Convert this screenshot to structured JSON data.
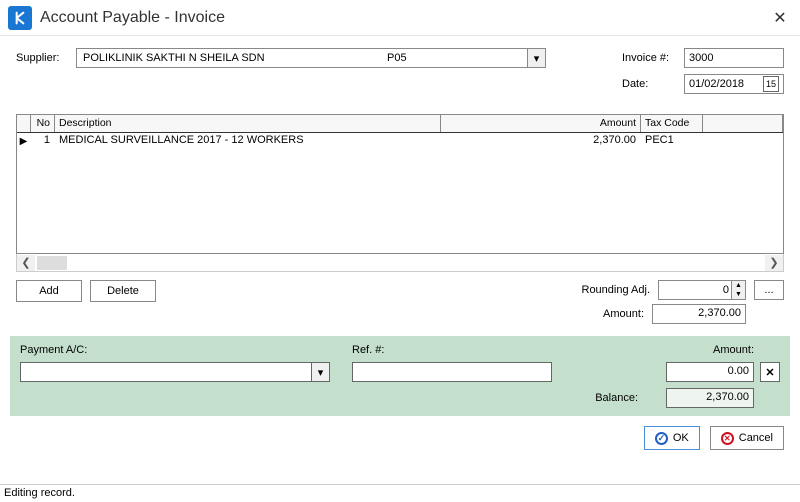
{
  "window": {
    "title": "Account Payable - Invoice"
  },
  "labels": {
    "supplier": "Supplier:",
    "invoice_no": "Invoice #:",
    "date": "Date:",
    "rounding_adj": "Rounding Adj.",
    "amount": "Amount:",
    "payment_ac": "Payment A/C:",
    "ref_no": "Ref. #:",
    "pay_amount": "Amount:",
    "balance": "Balance:"
  },
  "supplier": {
    "name": "POLIKLINIK SAKTHI N SHEILA SDN",
    "code": "P05"
  },
  "invoice": {
    "number": "3000",
    "date": "01/02/2018"
  },
  "grid": {
    "headers": {
      "no": "No",
      "description": "Description",
      "amount": "Amount",
      "tax_code": "Tax Code"
    },
    "rows": [
      {
        "no": "1",
        "description": "MEDICAL SURVEILLANCE 2017 - 12 WORKERS",
        "amount": "2,370.00",
        "tax_code": "PEC1"
      }
    ]
  },
  "totals": {
    "rounding_adj": "0",
    "amount": "2,370.00"
  },
  "payment": {
    "ac": "",
    "ref": "",
    "amount": "0.00",
    "balance": "2,370.00"
  },
  "buttons": {
    "add": "Add",
    "delete": "Delete",
    "ok": "OK",
    "cancel": "Cancel",
    "ellipsis": "..."
  },
  "status": "Editing record."
}
